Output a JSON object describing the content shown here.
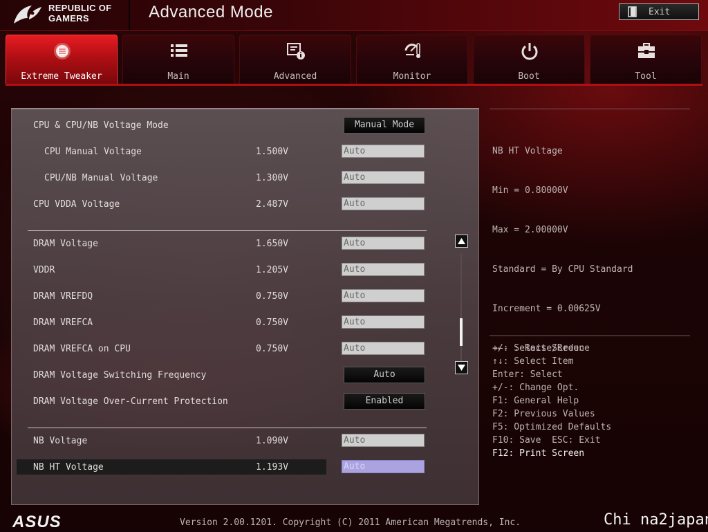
{
  "header": {
    "brand_line1": "REPUBLIC OF",
    "brand_line2": "GAMERS",
    "title": "Advanced Mode",
    "exit_label": "Exit"
  },
  "tabs": [
    {
      "label": "Extreme Tweaker",
      "icon": "tweaker-icon",
      "active": true
    },
    {
      "label": "Main",
      "icon": "list-icon",
      "active": false
    },
    {
      "label": "Advanced",
      "icon": "advanced-icon",
      "active": false
    },
    {
      "label": "Monitor",
      "icon": "monitor-icon",
      "active": false
    },
    {
      "label": "Boot",
      "icon": "power-icon",
      "active": false
    },
    {
      "label": "Tool",
      "icon": "toolbox-icon",
      "active": false
    }
  ],
  "settings": {
    "cpu_mode": {
      "label": "CPU & CPU/NB Voltage Mode",
      "value": "Manual Mode"
    },
    "cpu_manual": {
      "label": "CPU Manual Voltage",
      "reading": "1.500V",
      "value": "Auto"
    },
    "cpunb_manual": {
      "label": "CPU/NB Manual Voltage",
      "reading": "1.300V",
      "value": "Auto"
    },
    "cpu_vdda": {
      "label": "CPU VDDA Voltage",
      "reading": "2.487V",
      "value": "Auto"
    },
    "dram_voltage": {
      "label": "DRAM Voltage",
      "reading": "1.650V",
      "value": "Auto"
    },
    "vddr": {
      "label": "VDDR",
      "reading": "1.205V",
      "value": "Auto"
    },
    "dram_vrefdq": {
      "label": "DRAM VREFDQ",
      "reading": "0.750V",
      "value": "Auto"
    },
    "dram_vrefca": {
      "label": "DRAM VREFCA",
      "reading": "0.750V",
      "value": "Auto"
    },
    "dram_vrefca_cpu": {
      "label": "DRAM VREFCA on CPU",
      "reading": "0.750V",
      "value": "Auto"
    },
    "dram_switching": {
      "label": "DRAM Voltage Switching Frequency",
      "value": "Auto"
    },
    "dram_ocp": {
      "label": "DRAM Voltage Over-Current Protection",
      "value": "Enabled"
    },
    "nb_voltage": {
      "label": "NB Voltage",
      "reading": "1.090V",
      "value": "Auto"
    },
    "nb_ht_voltage": {
      "label": "NB HT Voltage",
      "reading": "1.193V",
      "value": "Auto"
    }
  },
  "help": {
    "lines": [
      "NB HT Voltage",
      "Min = 0.80000V",
      "Max = 2.00000V",
      "Standard = By CPU Standard",
      "Increment = 0.00625V",
      "+/- : Raise/Reduce"
    ]
  },
  "keys": [
    "→←: Select Screen",
    "↑↓: Select Item",
    "Enter: Select",
    "+/-: Change Opt.",
    "F1: General Help",
    "F2: Previous Values",
    "F5: Optimized Defaults",
    "F10: Save  ESC: Exit",
    "F12: Print Screen"
  ],
  "footer": {
    "brand": "ASUS",
    "version": "Version 2.00.1201. Copyright (C) 2011 American Megatrends, Inc.",
    "watermark": "Chi na2japan"
  },
  "colors": {
    "accent_red": "#e81c22",
    "selected_field": "#aaa3e0"
  }
}
